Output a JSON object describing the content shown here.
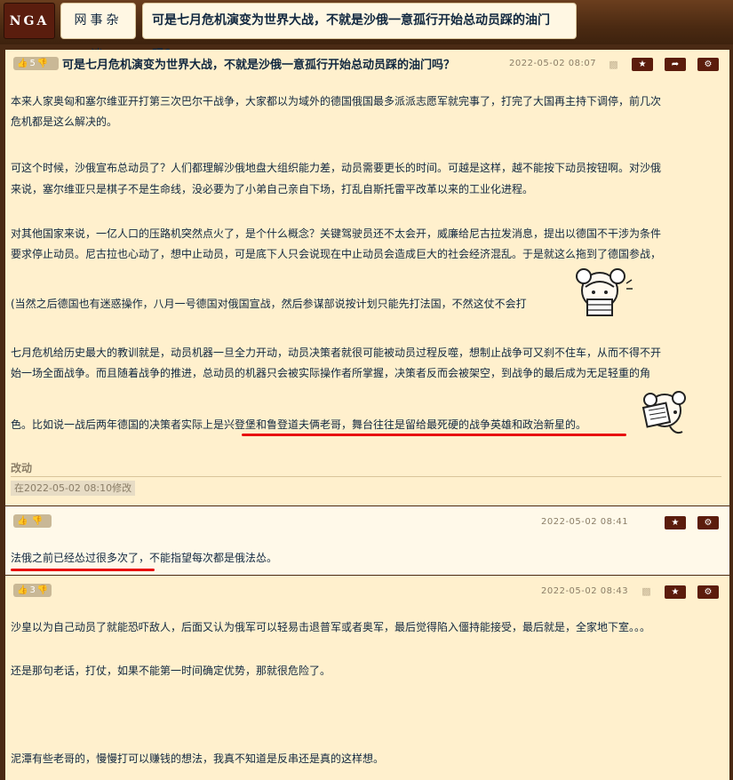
{
  "header": {
    "logo": "NGA",
    "board": "网事杂谈",
    "thread_title": "可是七月危机演变为世界大战，不就是沙俄一意孤行开始总动员踩的油门吗？"
  },
  "post1": {
    "likes": "5",
    "title": "可是七月危机演变为世界大战，不就是沙俄一意孤行开始总动员踩的油门吗？",
    "date": "2022-05-02 08:07",
    "paragraphs": {
      "p1a": "本来人家奥匈和塞尔维亚开打第三次巴尔干战争，大家都以为域外的德国俄国最多派派志愿军就完事了，打完了大国再主持下调停，前几次",
      "p1b": "危机都是这么解决的。",
      "p2a": "可这个时候，沙俄宣布总动员了？人们都理解沙俄地盘大组织能力差，动员需要更长的时间。可越是这样，越不能按下动员按钮啊。对沙俄",
      "p2b": "来说，塞尔维亚只是棋子不是生命线，没必要为了小弟自己亲自下场，打乱自斯托雷平改革以来的工业化进程。",
      "p3a": "对其他国家来说，一亿人口的压路机突然点火了，是个什么概念？关键驾驶员还不太会开，威廉给尼古拉发消息，提出以德国不干涉为条件",
      "p3b": "要求停止动员。尼古拉也心动了，想中止动员，可是底下人只会说现在中止动员会造成巨大的社会经济混乱。于是就这么拖到了德国参战，",
      "p4_before": "(当然之后德国也有迷惑操作，八月一号德国对俄国宣战，然后参谋部说按计划只能先打法国，不然这仗不会打",
      "p4_after": ")",
      "p5a": "七月危机给历史最大的教训就是，动员机器一旦全力开动，动员决策者就很可能被动员过程反噬，想制止战争可又刹不住车，从而不得不开",
      "p5b": "始一场全面战争。而且随着战争的推进，总动员的机器只会被实际操作者所掌握，决策者反而会被架空，到战争的最后成为无足轻重的角",
      "p6_before": "色。比如说一战后两年德国的决策者实际上是",
      "p6_highlight": "兴登堡和鲁登道夫俩老哥，舞台往往是留给最死硬的战争英雄和政治新星的",
      "p6_after": "。"
    },
    "edit_label": "改动",
    "edit_tag": "在2022-05-02 08:10修改"
  },
  "post2": {
    "likes": "",
    "date": "2022-05-02 08:41",
    "text_highlight": "法俄之前已经怂过很多次了",
    "text_after": "，不能指望每次都是俄法怂。"
  },
  "post3": {
    "likes": "3",
    "date": "2022-05-02 08:43",
    "p1": "沙皇以为自己动员了就能恐吓敌人，后面又认为俄军可以轻易击退普军或者奥军，最后觉得陷入僵持能接受，最后就是，全家地下室。。。",
    "p2": "还是那句老话，打仗，如果不能第一时间确定优势，那就很危险了。",
    "p3": "泥潭有些老哥的，慢慢打可以赚钱的想法，我真不知道是反串还是真的这样想。"
  },
  "icons": {
    "like": "thumbs-up-icon",
    "dislike": "thumbs-down-icon",
    "star": "star-icon",
    "share": "share-icon",
    "gear": "gear-icon",
    "android": "android-icon"
  },
  "colors": {
    "post_bg": "#fff0cd",
    "post_alt_bg": "#fff9e9",
    "brand_dark": "#5b1c0c",
    "highlight_line": "#e80f0f",
    "text": "#10273f"
  }
}
